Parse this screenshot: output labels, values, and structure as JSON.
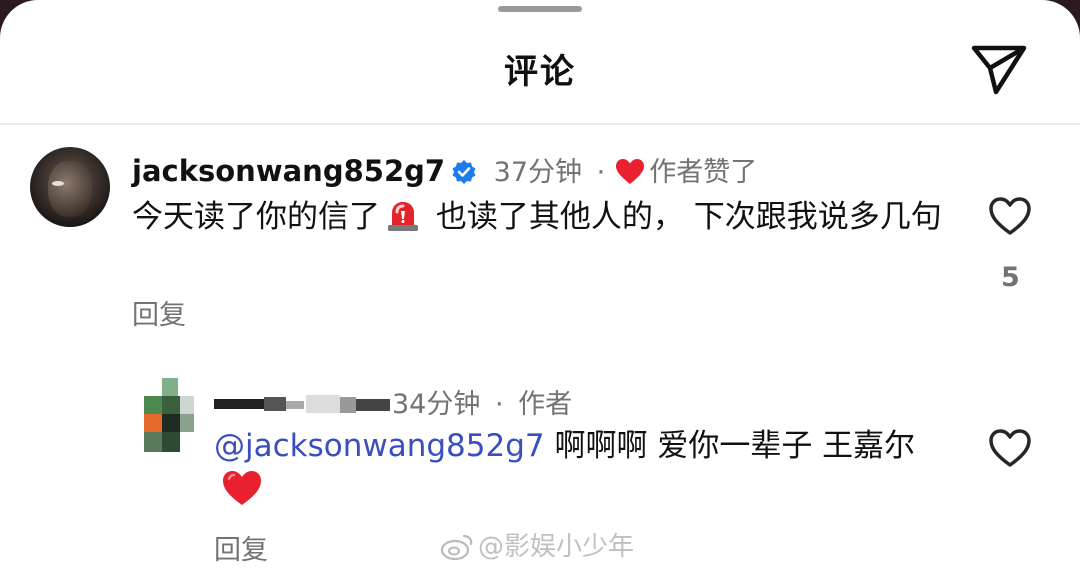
{
  "header": {
    "title": "评论"
  },
  "comments": [
    {
      "username": "jacksonwang852g7",
      "time": "37分钟",
      "separator": "·",
      "liked_by_author": "作者赞了",
      "text_before": "今天读了你的信了",
      "text_after": " 也读了其他人的， 下次跟我说多几句",
      "reply_label": "回复",
      "like_count": "5"
    }
  ],
  "replies": [
    {
      "time": "34分钟",
      "separator": "·",
      "author_tag": "作者",
      "mention": "@jacksonwang852g7",
      "text": " 啊啊啊 爱你一辈子 王嘉尔",
      "reply_label": "回复"
    }
  ],
  "watermark": {
    "text": "@影娱小少年"
  },
  "colors": {
    "accent_blue": "#3a4ec0",
    "heart_red": "#e8202f",
    "verified_blue": "#1d7bf0"
  }
}
